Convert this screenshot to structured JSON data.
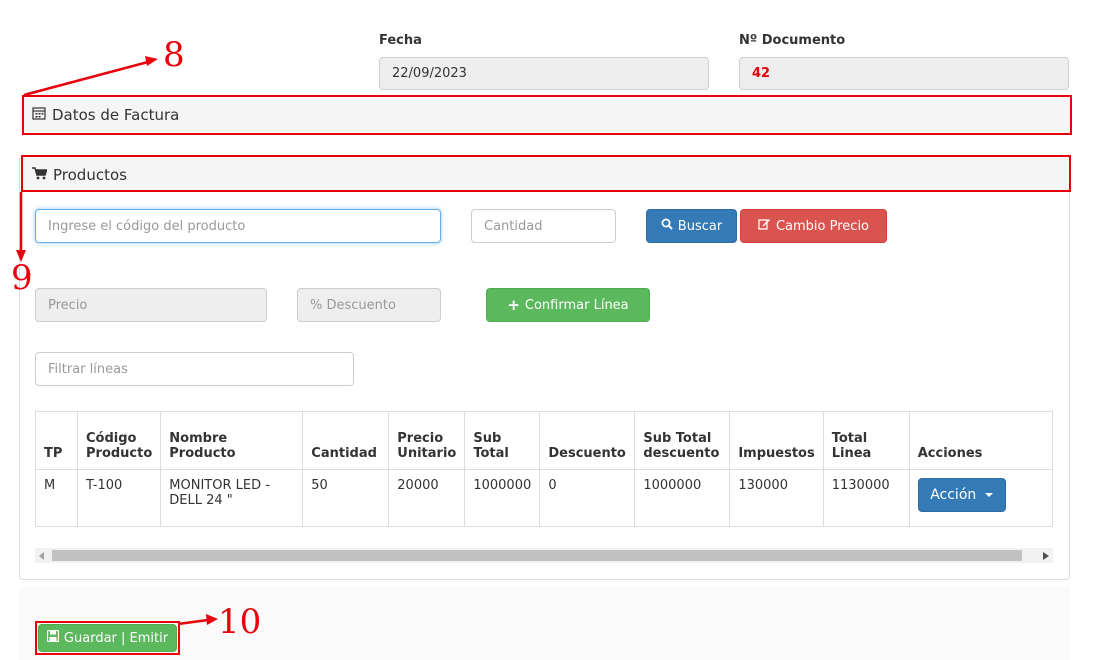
{
  "header": {
    "fecha_label": "Fecha",
    "fecha_value": "22/09/2023",
    "doc_label": "Nº Documento",
    "doc_value": "42"
  },
  "datos_factura": {
    "title": "Datos de Factura",
    "icon": "calendar-icon"
  },
  "productos": {
    "title": "Productos",
    "icon": "cart-icon",
    "codigo_placeholder": "Ingrese el código del producto",
    "cantidad_placeholder": "Cantidad",
    "buscar_label": "Buscar",
    "cambio_precio_label": "Cambio Precio",
    "precio_placeholder": "Precio",
    "descuento_placeholder": "% Descuento",
    "confirmar_label": "Confirmar Línea",
    "filtrar_placeholder": "Filtrar líneas"
  },
  "table": {
    "headers": [
      "TP",
      "Código Producto",
      "Nombre Producto",
      "Cantidad",
      "Precio Unitario",
      "Sub Total",
      "Descuento",
      "Sub Total descuento",
      "Impuestos",
      "Total Linea",
      "Acciones"
    ],
    "rows": [
      {
        "tp": "M",
        "codigo": "T-100",
        "nombre": "MONITOR LED - DELL 24 \"",
        "cantidad": "50",
        "precio": "20000",
        "subtotal": "1000000",
        "descuento": "0",
        "subtotal_desc": "1000000",
        "impuestos": "130000",
        "total": "1130000",
        "accion_label": "Acción"
      }
    ]
  },
  "footer": {
    "guardar_label": "Guardar | Emitir"
  },
  "annotations": {
    "a8": "8",
    "a9": "9",
    "a10": "10"
  },
  "colors": {
    "annotation": "#e8000b",
    "primary": "#337ab7",
    "danger": "#d9534f",
    "success": "#5cb85c"
  }
}
